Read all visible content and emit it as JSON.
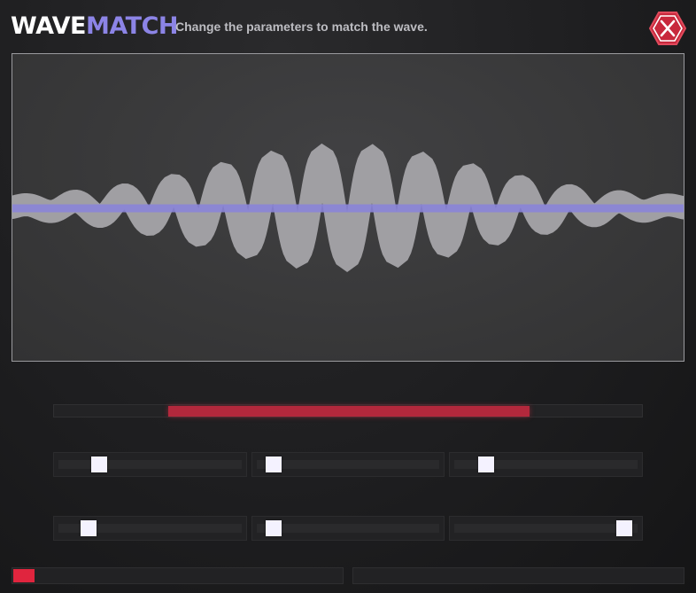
{
  "header": {
    "title_part1": "WAVE",
    "title_part2": "MATCH",
    "subtitle": "Change the parameters to match the wave.",
    "close_icon": "close-x-icon"
  },
  "colors": {
    "accent_purple": "#8c84e6",
    "progress_red": "#b3283c",
    "close_red": "#c8283c",
    "target_wave": "#a09fa3",
    "player_wave": "#8a84d8"
  },
  "timer_bar": {
    "start_fraction": 0.195,
    "end_fraction": 0.808
  },
  "sliders": [
    {
      "id": "param-1",
      "value": 0.2
    },
    {
      "id": "param-2",
      "value": 0.06
    },
    {
      "id": "param-3",
      "value": 0.15
    },
    {
      "id": "param-4",
      "value": 0.14
    },
    {
      "id": "param-5",
      "value": 0.06
    },
    {
      "id": "param-6",
      "value": 0.96
    }
  ],
  "attempt_progress": {
    "fraction": 0.065
  }
}
